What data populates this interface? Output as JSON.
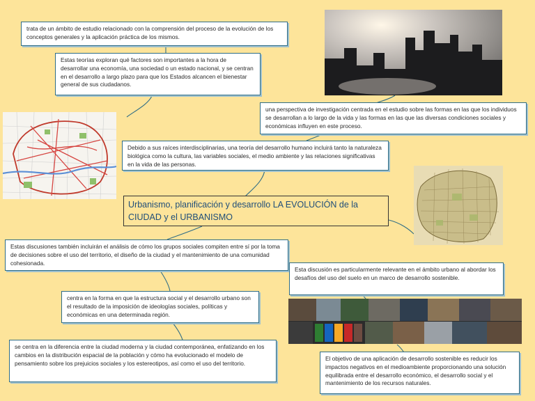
{
  "central_topic": "Urbanismo, planificación y desarrollo LA EVOLUCIÓN de la CIUDAD y el URBANISMO",
  "nodes": {
    "top_left": "trata de un ámbito de estudio relacionado con la comprensión del proceso de la evolución de los conceptos generales y la aplicación práctica de los mismos.",
    "theories": "Estas teorías exploran qué factores son importantes a la hora de desarrollar una economía, una sociedad o un estado nacional, y se centran en el desarrollo a largo plazo para que los Estados alcancen el bienestar general de sus ciudadanos.",
    "perspective": "una perspectiva de investigación centrada en el estudio sobre las formas en las que los individuos se desarrollan a lo largo de la vida y las formas en las que las diversas condiciones sociales y económicas influyen en este proceso.",
    "interdisciplinary": "Debido a sus raíces interdisciplinarias, una teoría del desarrollo humano incluirá tanto la naturaleza biológica como la cultura, las variables sociales, el medio ambiente y las relaciones significativas en la vida de las personas.",
    "discussions": "Estas discusiones también incluirán el análisis de cómo los grupos sociales compiten entre sí por la toma de decisiones sobre el uso del territorio, el diseño de la ciudad y el mantenimiento de una comunidad cohesionada.",
    "urban_relevance": "Esta discusión es particularmente relevante en el ámbito urbano al abordar los desafíos del uso del suelo en un marco de desarrollo sostenible.",
    "form_focus": "centra en la forma en que la estructura social y el desarrollo urbano son el resultado de la imposición de ideologías sociales, políticas y económicas en una determinada región.",
    "modern_city": "se centra en la diferencia entre la ciudad moderna y la ciudad contemporánea, enfatizando en los cambios en la distribución espacial de la población y cómo ha evolucionado el modelo de pensamiento sobre los prejuicios sociales y los estereotipos, así como el uso del territorio.",
    "sustainable": "El objetivo de una aplicación de desarrollo sostenible es reducir los impactos negativos en el medioambiente proporcionando una solución equilibrada entre el desarrollo económico, el desarrollo social y el mantenimiento de los recursos naturales."
  },
  "colors": {
    "background": "#fde49a",
    "box_border": "#2f6d86",
    "connector": "#2f6d86",
    "central_text": "#1f4e79"
  },
  "images": [
    "city-skyline-photo",
    "city-street-map",
    "old-city-map",
    "urban-collage-photo"
  ]
}
